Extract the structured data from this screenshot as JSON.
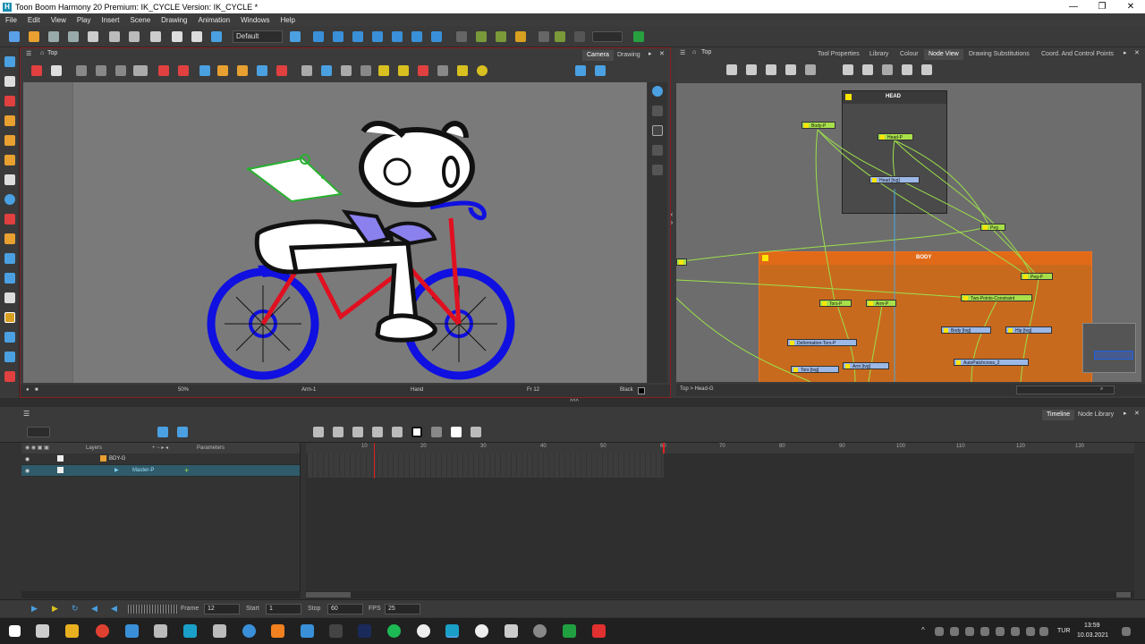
{
  "window": {
    "title": "Toon Boom Harmony 20 Premium: IK_CYCLE Version: IK_CYCLE *",
    "app_letter": "H"
  },
  "menu": [
    "File",
    "Edit",
    "View",
    "Play",
    "Insert",
    "Scene",
    "Drawing",
    "Animation",
    "Windows",
    "Help"
  ],
  "toolbar": {
    "workspace_select": "Default"
  },
  "camera_view": {
    "breadcrumb": "Top",
    "tabs": [
      {
        "label": "Camera",
        "active": true
      },
      {
        "label": "Drawing",
        "active": false
      }
    ],
    "status": {
      "zoom": "50%",
      "layer": "Arm-1",
      "tool": "Hand",
      "frame": "Fr 12",
      "color": "Black"
    }
  },
  "node_view": {
    "breadcrumb": "Top",
    "tabs": [
      {
        "label": "Tool Properties",
        "active": false
      },
      {
        "label": "Library",
        "active": false
      },
      {
        "label": "Colour",
        "active": false
      },
      {
        "label": "Node View",
        "active": true
      },
      {
        "label": "Drawing Substitutions",
        "active": false
      },
      {
        "label": "Coord. And Control Points",
        "active": false
      }
    ],
    "groups": {
      "head": "HEAD",
      "body": "BODY"
    },
    "nodes": {
      "body_p": "Body-P",
      "head_p": "Head-P",
      "head_tvg": "Head [tvg]",
      "peg": "Peg",
      "peg_p": "Peg-P",
      "two_points": "Two-Points-Constraint",
      "tors_p": "Tors-P",
      "arm_p": "Arm-P",
      "body_tvg": "Body [tvg]",
      "hip_tvg": "Hip [tvg]",
      "deformation": "Deformation-Tors-P",
      "tors_tvg": "Tors [tvg]",
      "arm_tvg": "Arm [tvg]",
      "autopatch": "AutoPatchcross_2"
    },
    "status_path": "Top > Head-G"
  },
  "timeline": {
    "tabs": [
      {
        "label": "Timeline",
        "active": true
      },
      {
        "label": "Node Library",
        "active": false
      }
    ],
    "layers_header": "Layers",
    "params_header": "Parameters",
    "layers": [
      {
        "name": "BDY-G",
        "selected": false
      },
      {
        "name": "Master-P",
        "selected": true
      }
    ],
    "ruler": [
      "10",
      "20",
      "30",
      "40",
      "50",
      "60",
      "70",
      "80",
      "90",
      "100",
      "110",
      "120",
      "130"
    ],
    "playback": {
      "frame_label": "Frame",
      "frame_value": "12",
      "start_label": "Start",
      "start_value": "1",
      "stop_label": "Stop",
      "stop_value": "60",
      "fps_label": "FPS",
      "fps_value": "25"
    }
  },
  "taskbar": {
    "time": "13:59",
    "date": "10.03.2021",
    "lang": "TUR"
  }
}
